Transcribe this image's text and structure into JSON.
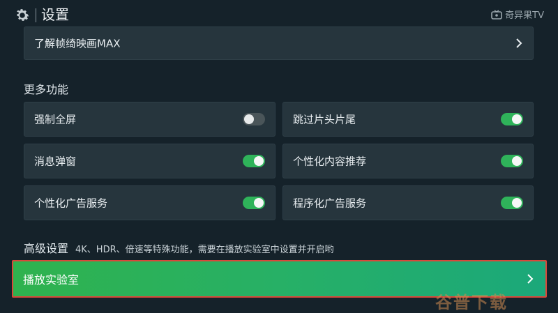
{
  "header": {
    "title": "设置",
    "brand": "奇异果TV",
    "icons": [
      "gear-icon",
      "tv-icon"
    ]
  },
  "top_item": {
    "label": "了解帧绮映画MAX",
    "icon": "chevron-right-icon"
  },
  "more_features": {
    "title": "更多功能",
    "items": [
      {
        "label": "强制全屏",
        "state": "off"
      },
      {
        "label": "跳过片头片尾",
        "state": "on"
      },
      {
        "label": "消息弹窗",
        "state": "on"
      },
      {
        "label": "个性化内容推荐",
        "state": "on"
      },
      {
        "label": "个性化广告服务",
        "state": "on"
      },
      {
        "label": "程序化广告服务",
        "state": "on"
      }
    ]
  },
  "advanced": {
    "title": "高级设置",
    "description": "4K、HDR、倍速等特殊功能，需要在播放实验室中设置并开启哟"
  },
  "lab_item": {
    "label": "播放实验室",
    "icon": "chevron-right-icon"
  },
  "watermark": "谷普下载",
  "colors": {
    "accent_green": "#2fb35a",
    "card_bg": "#26353d",
    "page_bg": "#15222a",
    "focus_border": "#d9473a"
  }
}
